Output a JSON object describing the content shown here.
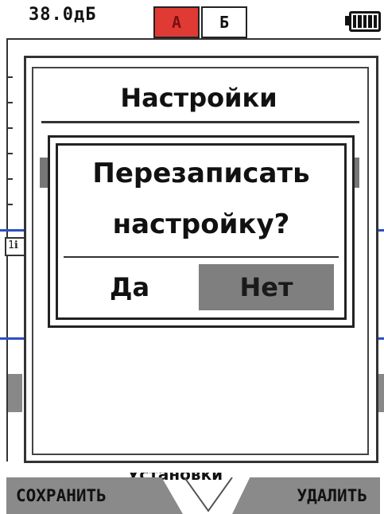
{
  "status": {
    "level": "38.0дБ",
    "channel_a": "А",
    "channel_b": "Б",
    "battery_icon": "battery-full-icon"
  },
  "graph": {
    "marker_label": "1ℹ"
  },
  "settings_panel": {
    "title": "Настройки",
    "partial_footer": "Установки"
  },
  "confirm_dialog": {
    "question_line1": "Перезаписать",
    "question_line2": "настройку?",
    "yes_label": "Да",
    "no_label": "Нет"
  },
  "softkeys": {
    "save_label": "СОХРАНИТЬ",
    "delete_label": "УДАЛИТЬ"
  },
  "colors": {
    "active_channel": "#e03a35",
    "selected_button": "#7f7f7f",
    "graph_line": "#2f4fc4"
  }
}
